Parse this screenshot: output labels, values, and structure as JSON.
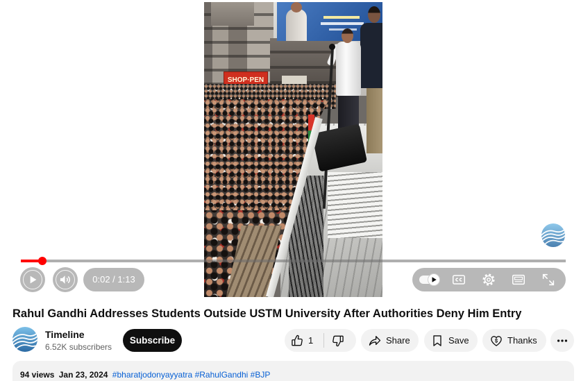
{
  "player": {
    "time_display": "0:02 / 1:13",
    "progress": 0.04,
    "autoplay": true,
    "video_sign_text": "SHOP·PEN",
    "icons": {
      "play": "play-icon",
      "volume": "volume-icon",
      "autoplay": "autoplay-toggle",
      "captions": "captions-icon",
      "settings": "gear-icon",
      "miniplayer": "miniplayer-icon",
      "fullscreen": "fullscreen-icon",
      "watermark": "channel-watermark-icon"
    }
  },
  "video": {
    "title": "Rahul Gandhi Addresses Students Outside USTM University After Authorities Deny Him Entry"
  },
  "channel": {
    "name": "Timeline",
    "subscribers": "6.52K subscribers",
    "subscribe_label": "Subscribe",
    "avatar_icon": "channel-avatar-icon"
  },
  "actions": {
    "like_count": "1",
    "share_label": "Share",
    "save_label": "Save",
    "thanks_label": "Thanks",
    "icons": {
      "like": "thumbs-up-icon",
      "dislike": "thumbs-down-icon",
      "share": "share-icon",
      "save": "bookmark-icon",
      "thanks": "thanks-icon",
      "more": "more-icon"
    }
  },
  "description": {
    "views": "94 views",
    "date": "Jan 23, 2024",
    "hashtags": [
      "#bharatjodonyayyatra",
      "#RahulGandhi",
      "#BJP"
    ]
  },
  "colors": {
    "progress": "#ff0000",
    "link": "#065fd4",
    "subscribe_bg": "#0f0f0f",
    "pill_bg": "#f2f2f2",
    "text": "#0f0f0f",
    "secondary_text": "#606060"
  }
}
